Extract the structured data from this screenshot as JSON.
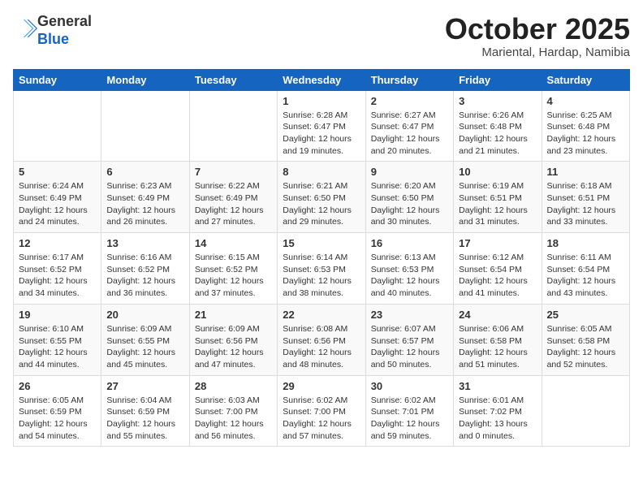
{
  "header": {
    "logo_line1": "General",
    "logo_line2": "Blue",
    "month": "October 2025",
    "location": "Mariental, Hardap, Namibia"
  },
  "weekdays": [
    "Sunday",
    "Monday",
    "Tuesday",
    "Wednesday",
    "Thursday",
    "Friday",
    "Saturday"
  ],
  "weeks": [
    [
      {
        "day": "",
        "info": ""
      },
      {
        "day": "",
        "info": ""
      },
      {
        "day": "",
        "info": ""
      },
      {
        "day": "1",
        "info": "Sunrise: 6:28 AM\nSunset: 6:47 PM\nDaylight: 12 hours and 19 minutes."
      },
      {
        "day": "2",
        "info": "Sunrise: 6:27 AM\nSunset: 6:47 PM\nDaylight: 12 hours and 20 minutes."
      },
      {
        "day": "3",
        "info": "Sunrise: 6:26 AM\nSunset: 6:48 PM\nDaylight: 12 hours and 21 minutes."
      },
      {
        "day": "4",
        "info": "Sunrise: 6:25 AM\nSunset: 6:48 PM\nDaylight: 12 hours and 23 minutes."
      }
    ],
    [
      {
        "day": "5",
        "info": "Sunrise: 6:24 AM\nSunset: 6:49 PM\nDaylight: 12 hours and 24 minutes."
      },
      {
        "day": "6",
        "info": "Sunrise: 6:23 AM\nSunset: 6:49 PM\nDaylight: 12 hours and 26 minutes."
      },
      {
        "day": "7",
        "info": "Sunrise: 6:22 AM\nSunset: 6:49 PM\nDaylight: 12 hours and 27 minutes."
      },
      {
        "day": "8",
        "info": "Sunrise: 6:21 AM\nSunset: 6:50 PM\nDaylight: 12 hours and 29 minutes."
      },
      {
        "day": "9",
        "info": "Sunrise: 6:20 AM\nSunset: 6:50 PM\nDaylight: 12 hours and 30 minutes."
      },
      {
        "day": "10",
        "info": "Sunrise: 6:19 AM\nSunset: 6:51 PM\nDaylight: 12 hours and 31 minutes."
      },
      {
        "day": "11",
        "info": "Sunrise: 6:18 AM\nSunset: 6:51 PM\nDaylight: 12 hours and 33 minutes."
      }
    ],
    [
      {
        "day": "12",
        "info": "Sunrise: 6:17 AM\nSunset: 6:52 PM\nDaylight: 12 hours and 34 minutes."
      },
      {
        "day": "13",
        "info": "Sunrise: 6:16 AM\nSunset: 6:52 PM\nDaylight: 12 hours and 36 minutes."
      },
      {
        "day": "14",
        "info": "Sunrise: 6:15 AM\nSunset: 6:52 PM\nDaylight: 12 hours and 37 minutes."
      },
      {
        "day": "15",
        "info": "Sunrise: 6:14 AM\nSunset: 6:53 PM\nDaylight: 12 hours and 38 minutes."
      },
      {
        "day": "16",
        "info": "Sunrise: 6:13 AM\nSunset: 6:53 PM\nDaylight: 12 hours and 40 minutes."
      },
      {
        "day": "17",
        "info": "Sunrise: 6:12 AM\nSunset: 6:54 PM\nDaylight: 12 hours and 41 minutes."
      },
      {
        "day": "18",
        "info": "Sunrise: 6:11 AM\nSunset: 6:54 PM\nDaylight: 12 hours and 43 minutes."
      }
    ],
    [
      {
        "day": "19",
        "info": "Sunrise: 6:10 AM\nSunset: 6:55 PM\nDaylight: 12 hours and 44 minutes."
      },
      {
        "day": "20",
        "info": "Sunrise: 6:09 AM\nSunset: 6:55 PM\nDaylight: 12 hours and 45 minutes."
      },
      {
        "day": "21",
        "info": "Sunrise: 6:09 AM\nSunset: 6:56 PM\nDaylight: 12 hours and 47 minutes."
      },
      {
        "day": "22",
        "info": "Sunrise: 6:08 AM\nSunset: 6:56 PM\nDaylight: 12 hours and 48 minutes."
      },
      {
        "day": "23",
        "info": "Sunrise: 6:07 AM\nSunset: 6:57 PM\nDaylight: 12 hours and 50 minutes."
      },
      {
        "day": "24",
        "info": "Sunrise: 6:06 AM\nSunset: 6:58 PM\nDaylight: 12 hours and 51 minutes."
      },
      {
        "day": "25",
        "info": "Sunrise: 6:05 AM\nSunset: 6:58 PM\nDaylight: 12 hours and 52 minutes."
      }
    ],
    [
      {
        "day": "26",
        "info": "Sunrise: 6:05 AM\nSunset: 6:59 PM\nDaylight: 12 hours and 54 minutes."
      },
      {
        "day": "27",
        "info": "Sunrise: 6:04 AM\nSunset: 6:59 PM\nDaylight: 12 hours and 55 minutes."
      },
      {
        "day": "28",
        "info": "Sunrise: 6:03 AM\nSunset: 7:00 PM\nDaylight: 12 hours and 56 minutes."
      },
      {
        "day": "29",
        "info": "Sunrise: 6:02 AM\nSunset: 7:00 PM\nDaylight: 12 hours and 57 minutes."
      },
      {
        "day": "30",
        "info": "Sunrise: 6:02 AM\nSunset: 7:01 PM\nDaylight: 12 hours and 59 minutes."
      },
      {
        "day": "31",
        "info": "Sunrise: 6:01 AM\nSunset: 7:02 PM\nDaylight: 13 hours and 0 minutes."
      },
      {
        "day": "",
        "info": ""
      }
    ]
  ]
}
